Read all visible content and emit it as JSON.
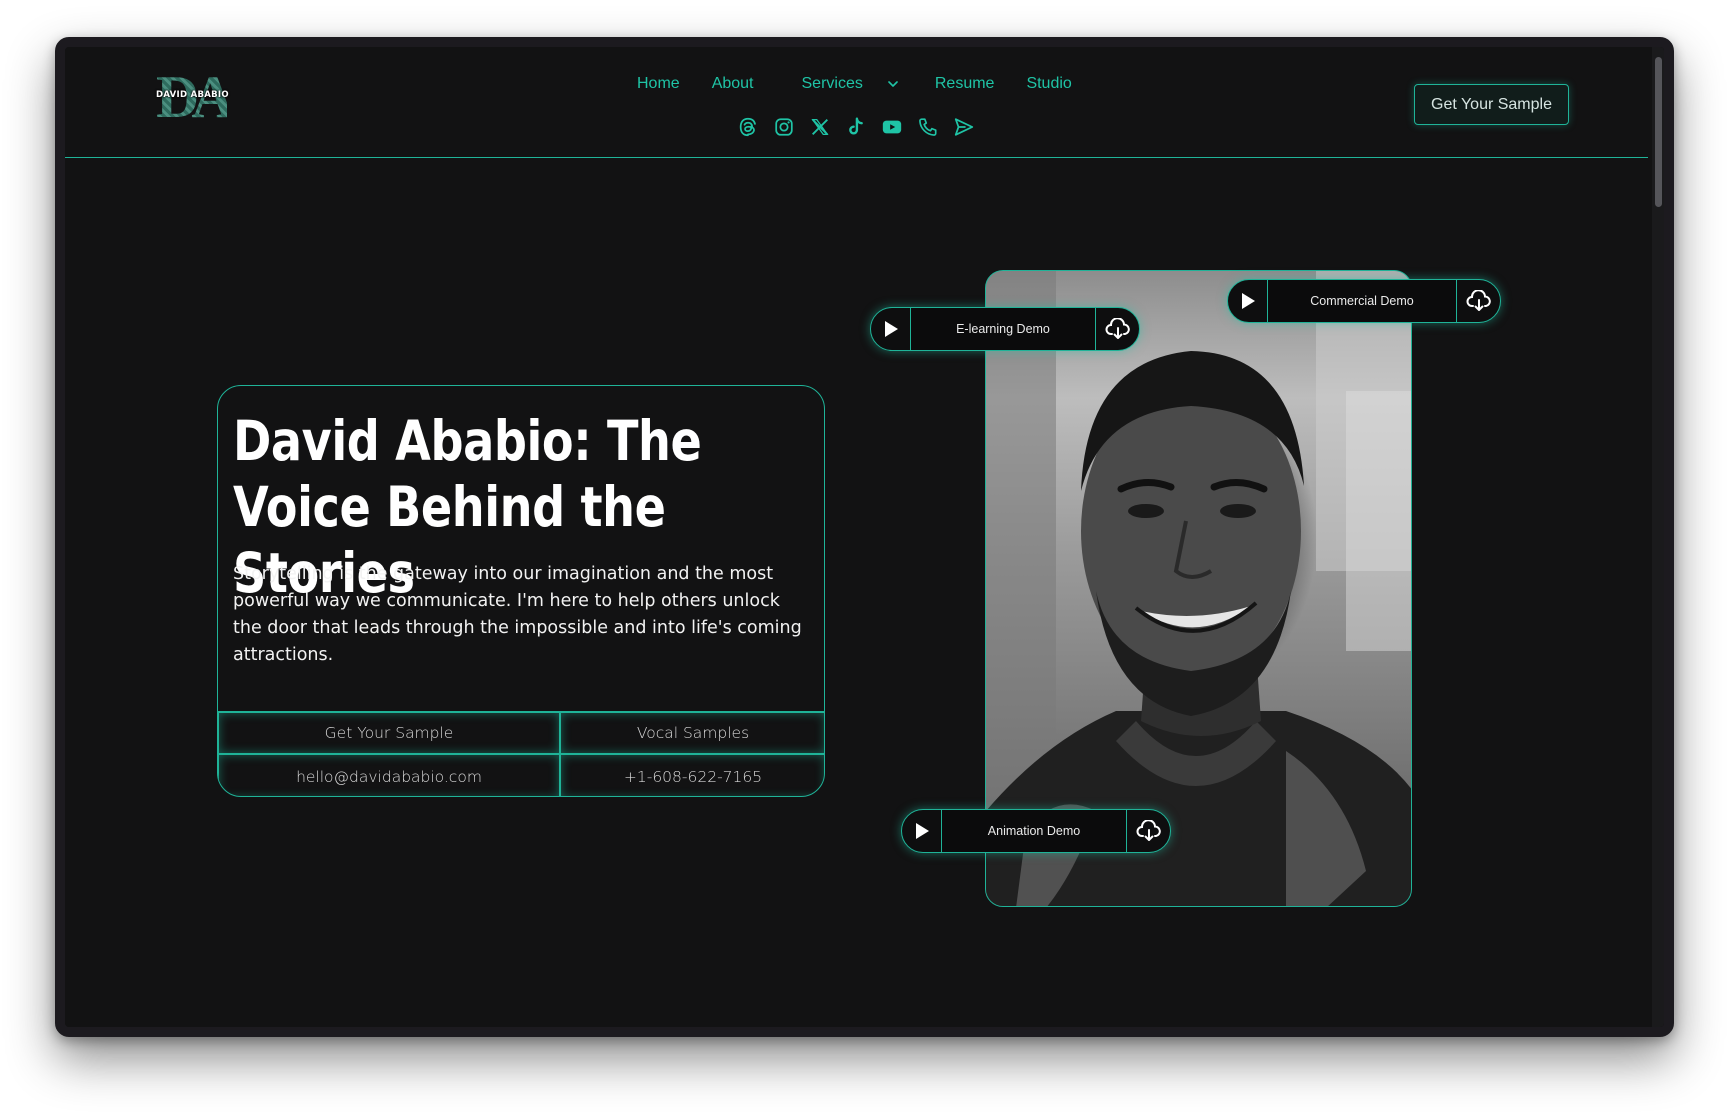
{
  "logo": {
    "monogram": "DA",
    "name": "DAVID ABABIO"
  },
  "nav": {
    "home": "Home",
    "about": "About",
    "services": "Services",
    "resume": "Resume",
    "studio": "Studio"
  },
  "socials": [
    "threads-icon",
    "instagram-icon",
    "x-icon",
    "tiktok-icon",
    "youtube-icon",
    "phone-icon",
    "send-icon"
  ],
  "header_cta": "Get Your Sample",
  "hero": {
    "title": "David Ababio: The Voice Behind the Stories",
    "body": "Storytelling is the gateway into our imagination and the most powerful way we communicate. I'm here to help others unlock the door that leads through the impossible and into life's coming attractions.",
    "cta_sample": "Get Your Sample",
    "cta_vocal": "Vocal Samples",
    "email": "hello@davidababio.com",
    "phone": "+1-608-622-7165"
  },
  "demos": {
    "elearning": "E-learning Demo",
    "commercial": "Commercial Demo",
    "animation": "Animation Demo"
  },
  "colors": {
    "accent": "#1fc4a6",
    "background": "#121213",
    "text": "#ffffff"
  }
}
